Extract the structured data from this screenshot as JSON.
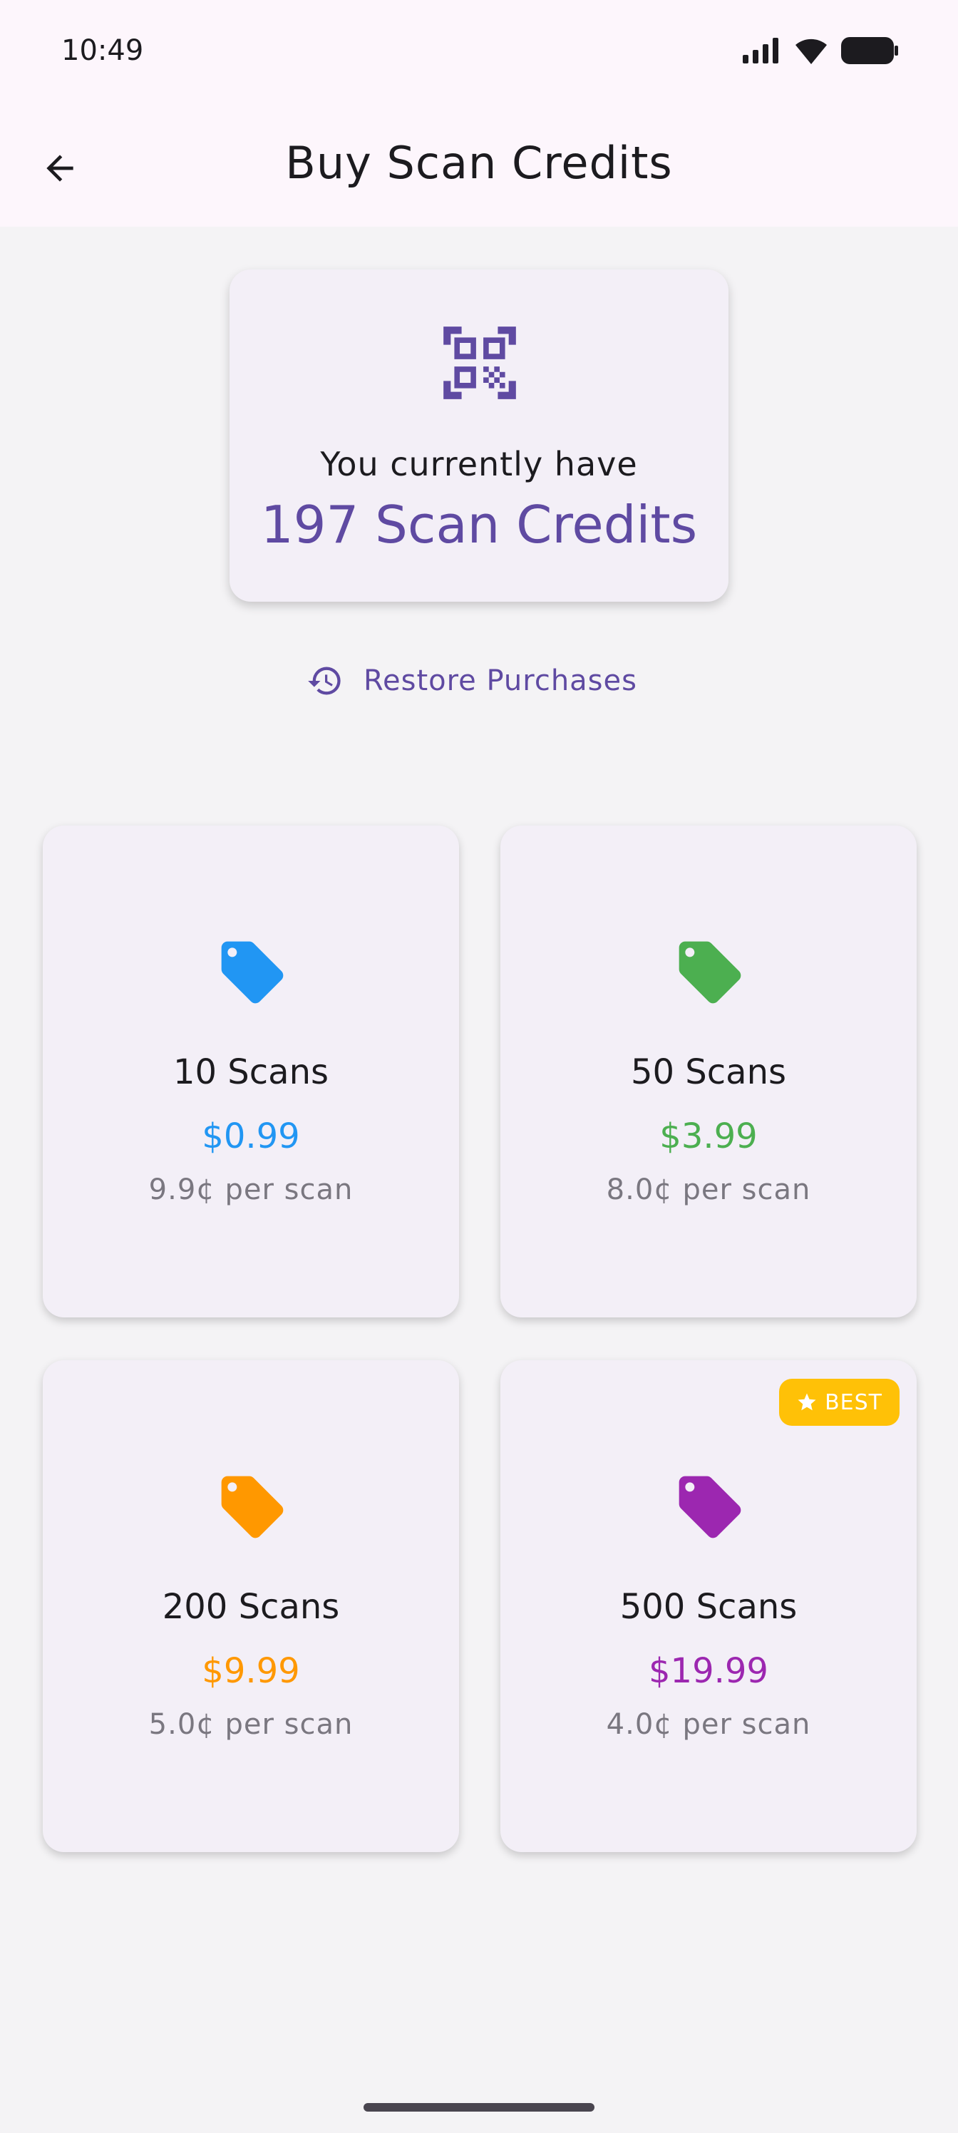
{
  "status_bar": {
    "time": "10:49"
  },
  "app_bar": {
    "title": "Buy Scan Credits"
  },
  "credits": {
    "line1": "You currently have",
    "line2": "197 Scan Credits",
    "accent": "#5f4aa2"
  },
  "restore": {
    "label": "Restore Purchases"
  },
  "packages": [
    {
      "name": "10 Scans",
      "price": "$0.99",
      "per_scan": "9.9¢ per scan",
      "color": "#2196f3"
    },
    {
      "name": "50 Scans",
      "price": "$3.99",
      "per_scan": "8.0¢ per scan",
      "color": "#4caf50"
    },
    {
      "name": "200 Scans",
      "price": "$9.99",
      "per_scan": "5.0¢ per scan",
      "color": "#ff9800"
    },
    {
      "name": "500 Scans",
      "price": "$19.99",
      "per_scan": "4.0¢ per scan",
      "color": "#9c27b0",
      "badge": "BEST"
    }
  ],
  "icons": {
    "back": "arrow-left-icon",
    "qr": "qr-code-scanner-icon",
    "restore": "history-icon",
    "tag": "price-tag-icon",
    "star": "star-icon"
  }
}
